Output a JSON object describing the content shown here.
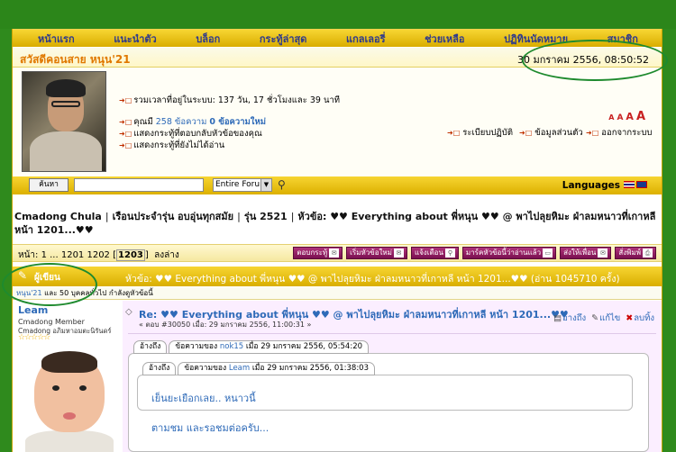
{
  "nav": {
    "items": [
      {
        "name": "nav-home",
        "label": "หน้าแรก"
      },
      {
        "name": "nav-intro",
        "label": "แนะนำตัว"
      },
      {
        "name": "nav-blog",
        "label": "บล็อก"
      },
      {
        "name": "nav-recent",
        "label": "กระทู้ล่าสุด"
      },
      {
        "name": "nav-gallery",
        "label": "แกลเลอรี่"
      },
      {
        "name": "nav-help",
        "label": "ช่วยเหลือ"
      },
      {
        "name": "nav-calendar",
        "label": "ปฏิทินนัดหมาย"
      },
      {
        "name": "nav-members",
        "label": "สมาชิก"
      }
    ]
  },
  "welcome": {
    "greeting": "สวัสดีคอนสาย หนุน'21",
    "datetime": "30 มกราคม 2556, 08:50:52"
  },
  "profile": {
    "total_time": "รวมเวลาที่อยู่ในระบบ: 137 วัน, 17 ชั่วโมงและ 39 นาที",
    "posts_prefix": "คุณมี",
    "posts_count": "258 ข้อความ",
    "posts_new": "0 ข้อความใหม่",
    "replies_link": "แสดงกระทู้ที่ตอบกลับหัวข้อของคุณ",
    "unread_link": "แสดงกระทู้ที่ยังไม่ได้อ่าน",
    "fontsizes": [
      "A",
      "A",
      "A",
      "A"
    ],
    "calendar_link": "ระเบียบปฏิบัติ",
    "profile_link": "ข้อมูลส่วนตัว",
    "logout_link": "ออกจากระบบ"
  },
  "search": {
    "button": "ค้นหา",
    "scope": "Entire Forum",
    "languages": "Languages"
  },
  "breadcrumb": {
    "items": [
      "Cmadong Chula",
      "เรือนประจำรุ่น อบอุ่นทุกสมัย",
      "รุ่น 2521",
      "หัวข้อ: ♥♥ Everything about พี่หนุน ♥♥ @ พาไปลุยหิมะ ฝ่าลมหนาวที่เกาหลี หน้า 1201...♥♥"
    ]
  },
  "pagination": {
    "prefix": "หน้า: 1 ... 1201 1202",
    "current": "1203",
    "down": "ลงล่าง"
  },
  "actions": [
    "ตอบกระทู้",
    "เริ่มหัวข้อใหม่",
    "แจ้งเตือน",
    "มาร์คหัวข้อนี้ว่าอ่านแล้ว",
    "ส่งให้เพื่อน",
    "สั่งพิมพ์"
  ],
  "topic_header": {
    "author": "ผู้เขียน",
    "topic": "หัวข้อ: ♥♥ Everything about พี่หนุน ♥♥ @ พาไปลุยหิมะ ฝ่าลมหนาวที่เกาหลี หน้า 1201...♥♥  (อ่าน 1045710 ครั้ง)"
  },
  "viewers": {
    "user": "หนุน'21",
    "rest": "และ 50 บุคคลทั่วไป กำลังดูหัวข้อนี้"
  },
  "post": {
    "poster_name": "Leam",
    "poster_rank": "Cmadong Member",
    "poster_rank2": "Cmadong อภิมหาอมตะนิรันดร์",
    "stars": "☆☆☆☆☆",
    "title": "Re: ♥♥ Everything about พี่หนุน ♥♥ @ พาไปลุยหิมะ ฝ่าลมหนาวที่เกาหลี หน้า 1201...♥♥",
    "meta": "« ตอบ #30050 เมื่อ: 29 มกราคม 2556, 11:00:31 »",
    "tools": {
      "quote": "อ้างถึง",
      "edit": "แก้ไข",
      "delete": "ลบทิ้ง"
    },
    "quote1": {
      "tab": "อ้างถึง",
      "label": "ข้อความของ",
      "user": "nok15",
      "when": "เมื่อ 29 มกราคม 2556, 05:54:20"
    },
    "quote2": {
      "tab": "อ้างถึง",
      "label": "ข้อความของ",
      "user": "Leam",
      "when": "เมื่อ 29 มกราคม 2556, 01:38:03"
    },
    "quote2_text": "เย็นยะเยือกเลย.. หนาวนี้",
    "reply_text": "ตามชม และรอชมต่อครับ..."
  }
}
